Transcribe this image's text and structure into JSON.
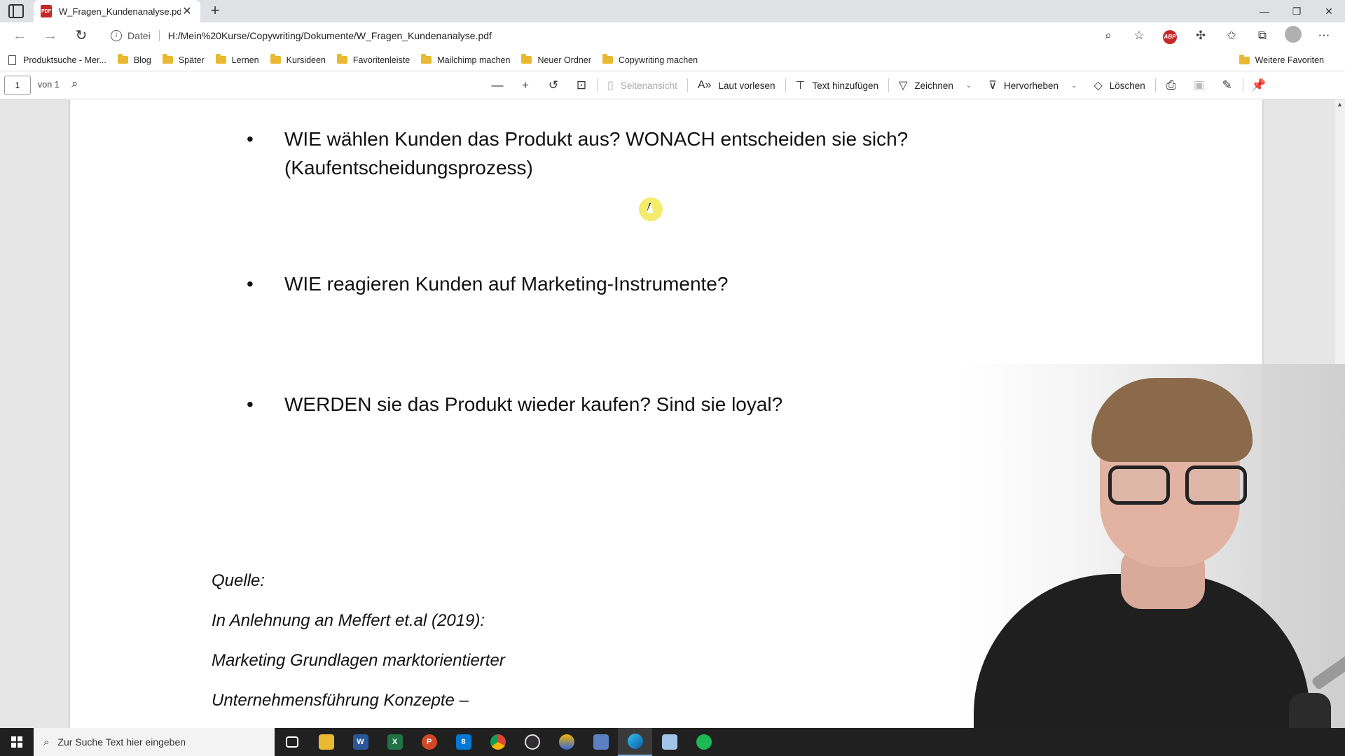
{
  "browser": {
    "tab_title": "W_Fragen_Kundenanalyse.pdf",
    "scheme_label": "Datei",
    "url": "H:/Mein%20Kurse/Copywriting/Dokumente/W_Fragen_Kundenanalyse.pdf"
  },
  "bookmarks": {
    "items": [
      {
        "label": "Produktsuche - Mer...",
        "icon": "page-icon"
      },
      {
        "label": "Blog",
        "icon": "folder-icon"
      },
      {
        "label": "Später",
        "icon": "folder-icon"
      },
      {
        "label": "Lernen",
        "icon": "folder-icon"
      },
      {
        "label": "Kursideen",
        "icon": "folder-icon"
      },
      {
        "label": "Favoritenleiste",
        "icon": "folder-icon"
      },
      {
        "label": "Mailchimp machen",
        "icon": "folder-icon"
      },
      {
        "label": "Neuer Ordner",
        "icon": "folder-icon"
      },
      {
        "label": "Copywriting machen",
        "icon": "folder-icon"
      }
    ],
    "other": "Weitere Favoriten"
  },
  "pdf_toolbar": {
    "page_number": "1",
    "page_of": "von 1",
    "page_view": "Seitenansicht",
    "read_aloud": "Laut vorlesen",
    "add_text": "Text hinzufügen",
    "draw": "Zeichnen",
    "highlight": "Hervorheben",
    "erase": "Löschen"
  },
  "document": {
    "bullets": [
      "WIE wählen Kunden das Produkt aus? WONACH entscheiden sie sich?",
      "(Kaufentscheidungsprozess)",
      "WIE reagieren Kunden auf Marketing-Instrumente?",
      "WERDEN sie das Produkt wieder kaufen? Sind sie loyal?"
    ],
    "source_lines": [
      "Quelle:",
      "In Anlehnung an Meffert et.al (2019):",
      "Marketing Grundlagen marktorientierter",
      "Unternehmensführung Konzepte –"
    ]
  },
  "taskbar": {
    "search_placeholder": "Zur Suche Text hier eingeben",
    "mail_badge": "8"
  },
  "colors": {
    "accent": "#0078d4",
    "pdf_red": "#c62828",
    "folder": "#e8b931"
  }
}
